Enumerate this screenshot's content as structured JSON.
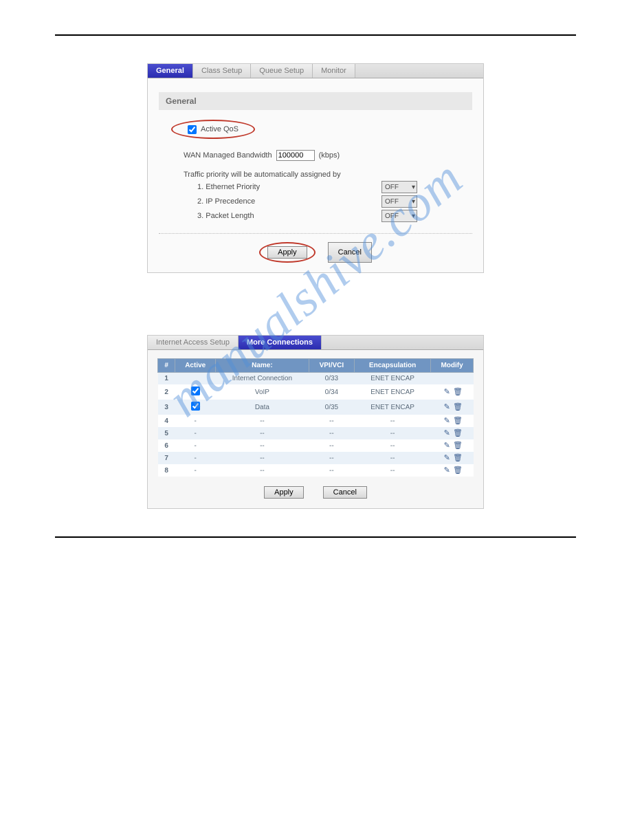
{
  "watermark": "manualshive.com",
  "panel1": {
    "tabs": [
      "General",
      "Class Setup",
      "Queue Setup",
      "Monitor"
    ],
    "active_tab": 0,
    "section_title": "General",
    "active_qos_label": "Active QoS",
    "bandwidth_label": "WAN Managed Bandwidth",
    "bandwidth_value": "100000",
    "bandwidth_unit": "(kbps)",
    "priority_intro": "Traffic priority will be automatically assigned by",
    "priority_items": [
      {
        "label": "1. Ethernet Priority",
        "value": "OFF"
      },
      {
        "label": "2. IP Precedence",
        "value": "OFF"
      },
      {
        "label": "3. Packet Length",
        "value": "OFF"
      }
    ],
    "apply_label": "Apply",
    "cancel_label": "Cancel"
  },
  "panel2": {
    "tabs": [
      "Internet Access Setup",
      "More Connections"
    ],
    "active_tab": 1,
    "columns": [
      "#",
      "Active",
      "Name:",
      "VPI/VCI",
      "Encapsulation",
      "Modify"
    ],
    "rows": [
      {
        "n": "1",
        "active": "",
        "name": "Internet Connection",
        "vpi": "0/33",
        "enc": "ENET ENCAP",
        "modify": false
      },
      {
        "n": "2",
        "active": "check",
        "name": "VoIP",
        "vpi": "0/34",
        "enc": "ENET ENCAP",
        "modify": true
      },
      {
        "n": "3",
        "active": "check",
        "name": "Data",
        "vpi": "0/35",
        "enc": "ENET ENCAP",
        "modify": true
      },
      {
        "n": "4",
        "active": "-",
        "name": "--",
        "vpi": "--",
        "enc": "--",
        "modify": true
      },
      {
        "n": "5",
        "active": "-",
        "name": "--",
        "vpi": "--",
        "enc": "--",
        "modify": true
      },
      {
        "n": "6",
        "active": "-",
        "name": "--",
        "vpi": "--",
        "enc": "--",
        "modify": true
      },
      {
        "n": "7",
        "active": "-",
        "name": "--",
        "vpi": "--",
        "enc": "--",
        "modify": true
      },
      {
        "n": "8",
        "active": "-",
        "name": "--",
        "vpi": "--",
        "enc": "--",
        "modify": true
      }
    ],
    "apply_label": "Apply",
    "cancel_label": "Cancel"
  }
}
